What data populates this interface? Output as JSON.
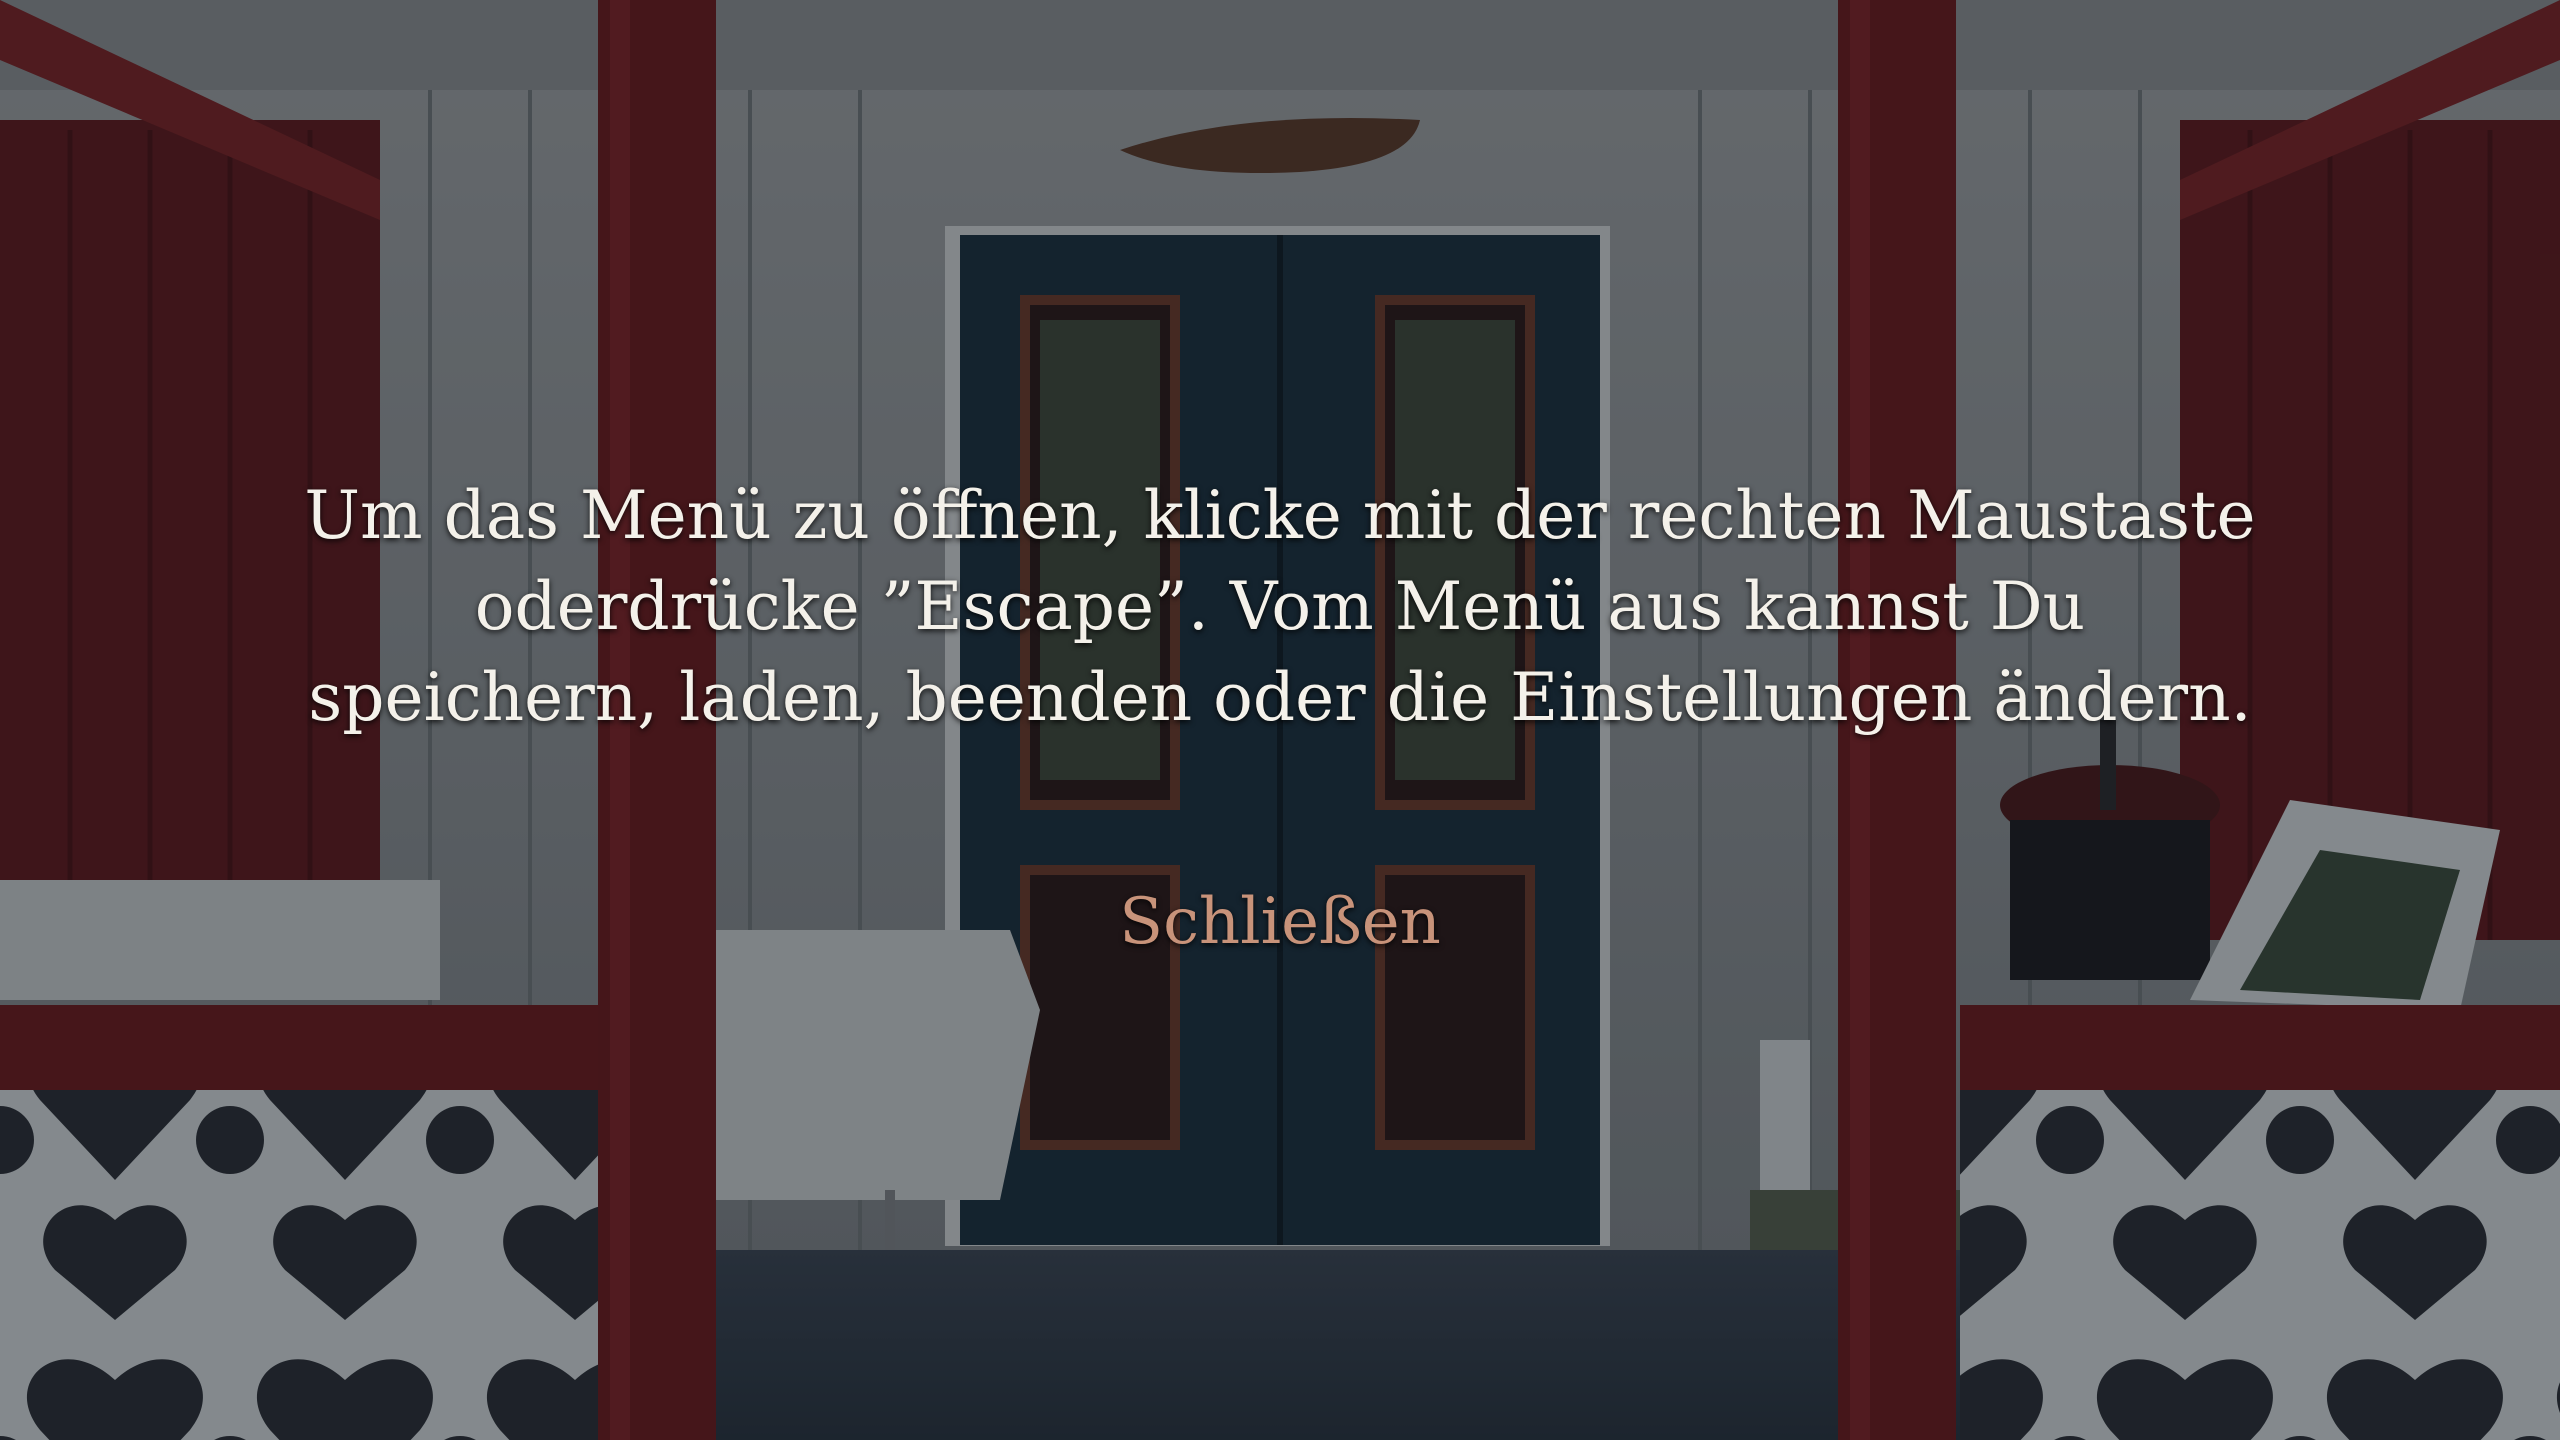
{
  "notice": {
    "lines": [
      "Um das Menü zu öffnen, klicke mit der rechten Maustaste",
      "oderdrücke ”Escape”. Vom Menü aus kannst Du",
      "speichern, laden, beenden oder die Einstellungen ändern."
    ],
    "close_label": "Schließen"
  },
  "colors": {
    "text": "#f4f1ea",
    "button_text": "#c8937a",
    "porch_red": "#6e1f22",
    "door_blue": "#1b3140",
    "wall_white": "#8f969a"
  }
}
